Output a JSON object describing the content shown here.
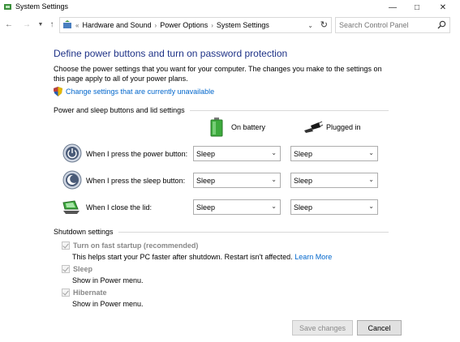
{
  "window": {
    "title": "System Settings"
  },
  "address": {
    "crumbs": [
      "Hardware and Sound",
      "Power Options",
      "System Settings"
    ],
    "search_placeholder": "Search Control Panel"
  },
  "main": {
    "heading": "Define power buttons and turn on password protection",
    "description": "Choose the power settings that you want for your computer. The changes you make to the settings on this page apply to all of your power plans.",
    "change_link": "Change settings that are currently unavailable"
  },
  "power_group": {
    "label": "Power and sleep buttons and lid settings",
    "col_battery": "On battery",
    "col_plugged": "Plugged in",
    "rows": [
      {
        "label": "When I press the power button:",
        "battery": "Sleep",
        "plugged": "Sleep"
      },
      {
        "label": "When I press the sleep button:",
        "battery": "Sleep",
        "plugged": "Sleep"
      },
      {
        "label": "When I close the lid:",
        "battery": "Sleep",
        "plugged": "Sleep"
      }
    ]
  },
  "shutdown_group": {
    "label": "Shutdown settings",
    "items": [
      {
        "label": "Turn on fast startup (recommended)",
        "sub": "This helps start your PC faster after shutdown. Restart isn't affected.",
        "link": "Learn More"
      },
      {
        "label": "Sleep",
        "sub": "Show in Power menu."
      },
      {
        "label": "Hibernate",
        "sub": "Show in Power menu."
      }
    ]
  },
  "footer": {
    "save": "Save changes",
    "cancel": "Cancel"
  }
}
